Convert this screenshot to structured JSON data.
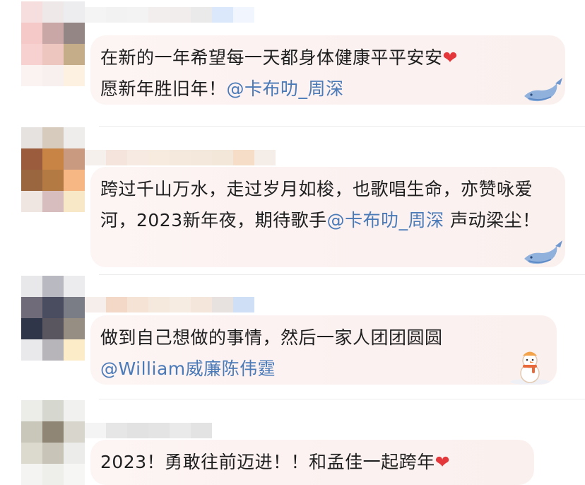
{
  "comments": [
    {
      "text": "在新的一年希望每一天都身体健康平平安安",
      "heart": "❤",
      "line2": "愿新年胜旧年！",
      "mention": "@卡布叻_周深",
      "decoration_icon": "whale-icon"
    },
    {
      "text": "跨过千山万水，走过岁月如梭，也歌唱生命，亦赞咏爱河，2023新年夜，期待歌手",
      "mention": "@卡布叻_周深",
      "text_after": " 声动梁尘！",
      "decoration_icon": "whale-icon"
    },
    {
      "text": "做到自己想做的事情，然后一家人团团圆圆",
      "mention": "@William威廉陈伟霆",
      "decoration_icon": "snowman-icon"
    },
    {
      "text": "2023！勇敢往前迈进！！和孟佳一起跨年",
      "heart": "❤"
    }
  ],
  "colors": {
    "mention": "#4a7ab8",
    "heart": "#e4373b",
    "bubble": "#fbf2f1"
  }
}
